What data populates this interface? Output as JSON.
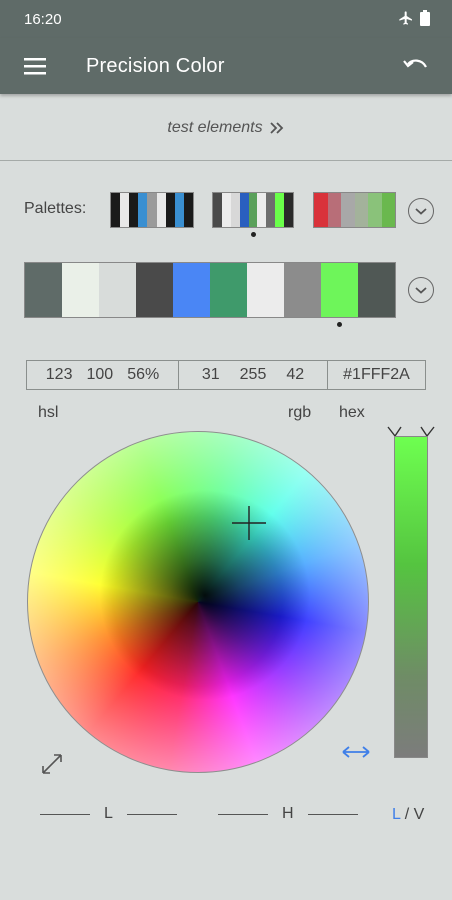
{
  "status_bar": {
    "time": "16:20",
    "icons": [
      "airplane-icon",
      "battery-icon"
    ]
  },
  "app_bar": {
    "title": "Precision Color",
    "menu_icon": "hamburger-menu-icon",
    "undo_icon": "undo-icon"
  },
  "test_link": {
    "label": "test elements",
    "icon": "double-chevron-right-icon"
  },
  "palettes": {
    "label": "Palettes:",
    "mini": [
      [
        "#1a1a1a",
        "#e8e8e8",
        "#1a1a1a",
        "#3a8fd1",
        "#9a9a9a",
        "#e8e8e8",
        "#1a1a1a",
        "#3a8fd1",
        "#1a1a1a"
      ],
      [
        "#4a4a4a",
        "#ececec",
        "#d8d8d8",
        "#2a5fbf",
        "#5aa05a",
        "#ececec",
        "#6e6e6e",
        "#6aff4a",
        "#2a2a2a"
      ],
      [
        "#d9323a",
        "#b86e78",
        "#a8a8a8",
        "#a3b29b",
        "#8ac27a",
        "#6ab84e"
      ]
    ],
    "selected_mini": 1,
    "current": [
      "#5f6b68",
      "#eaf0e8",
      "#d8dcda",
      "#4a4a4a",
      "#4a86f5",
      "#3f9a6b",
      "#ececec",
      "#8c8c8c",
      "#6ef55a",
      "#505855"
    ],
    "selected_swatch": 8
  },
  "values": {
    "hsl": [
      "123",
      "100",
      "56%"
    ],
    "rgb": [
      "31",
      "255",
      "42"
    ],
    "hex": "#1FFF2A",
    "hsl_label": "hsl",
    "rgb_label": "rgb",
    "hex_label": "hex"
  },
  "controls": {
    "l_label": "L",
    "h_label": "H",
    "mode_l": "L",
    "mode_sep": " / ",
    "mode_v": "V"
  },
  "colors": {
    "accent": "#3f7fe8",
    "bar": "#5f6b68",
    "background": "#d9dddc"
  }
}
